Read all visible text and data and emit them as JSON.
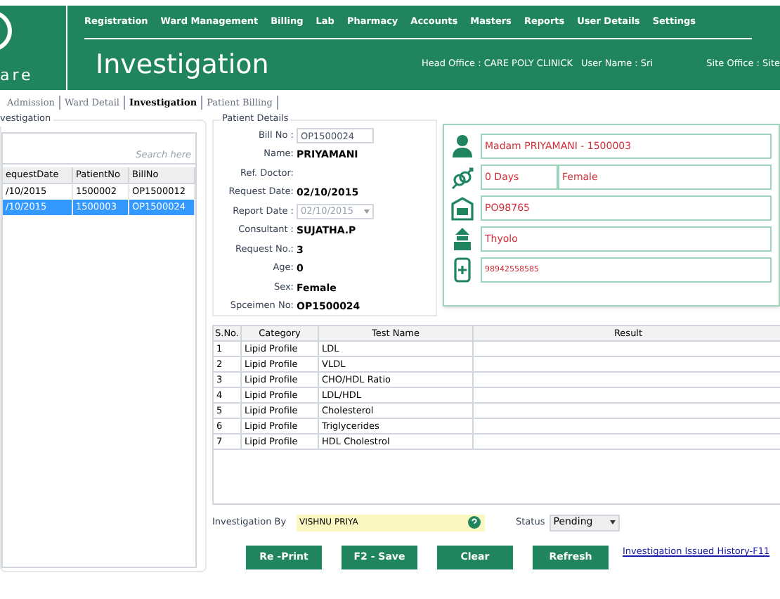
{
  "logo": {
    "text": "are"
  },
  "nav": [
    "Registration",
    "Ward Management",
    "Billing",
    "Lab",
    "Pharmacy",
    "Accounts",
    "Masters",
    "Reports",
    "User Details",
    "Settings"
  ],
  "page_title": "Investigation",
  "head_office": "Head Office :  CARE POLY CLINICK",
  "user_name": "User Name : Sri",
  "site_office": "Site Office : Site",
  "tabs": [
    {
      "label": "Admission",
      "selected": false
    },
    {
      "label": "Ward Detail",
      "selected": false
    },
    {
      "label": "Investigation",
      "selected": true
    },
    {
      "label": "Patient Billing",
      "selected": false
    }
  ],
  "left_panel": {
    "title": "vestigation",
    "search_placeholder": "Search here",
    "columns": [
      "equestDate",
      "PatientNo",
      "BillNo"
    ],
    "rows": [
      {
        "cells": [
          "/10/2015",
          "1500002",
          "OP1500012"
        ],
        "selected": false
      },
      {
        "cells": [
          "/10/2015",
          "1500003",
          "OP1500024"
        ],
        "selected": true
      }
    ]
  },
  "patient_details": {
    "title": "Patient Details",
    "fields": [
      {
        "label": "Bill No :",
        "value": "OP1500024",
        "kind": "input"
      },
      {
        "label": "Name:",
        "value": "PRIYAMANI",
        "kind": "text"
      },
      {
        "label": "Ref. Doctor:",
        "kind": "text"
      },
      {
        "label": "Request Date:",
        "value": "02/10/2015",
        "kind": "text"
      },
      {
        "label": "Report Date :",
        "value": "02/10/2015",
        "kind": "select"
      },
      {
        "label": "Consultant :",
        "value": "SUJATHA.P",
        "kind": "text"
      },
      {
        "label": "Request No.:",
        "value": "3",
        "kind": "text"
      },
      {
        "label": "Age:",
        "value": "0",
        "kind": "text"
      },
      {
        "label": "Sex:",
        "value": "Female",
        "kind": "text"
      },
      {
        "label": "Spceimen No:",
        "value": "OP1500024",
        "kind": "text"
      }
    ]
  },
  "contact_card": [
    {
      "kind": "person",
      "values": [
        "Madam PRIYAMANI - 1500003"
      ]
    },
    {
      "kind": "gender",
      "values": [
        "0 Days",
        "Female"
      ]
    },
    {
      "kind": "mail",
      "values": [
        "PO98765"
      ]
    },
    {
      "kind": "place",
      "values": [
        "Thyolo"
      ]
    },
    {
      "kind": "phone",
      "values": [
        "98942558585"
      ]
    }
  ],
  "tests_table": {
    "columns": [
      "S.No.",
      "Category",
      "Test Name",
      "Result"
    ],
    "rows": [
      [
        "1",
        "Lipid Profile",
        "LDL"
      ],
      [
        "2",
        "Lipid Profile",
        "VLDL"
      ],
      [
        "3",
        "Lipid Profile",
        "CHO/HDL Ratio"
      ],
      [
        "4",
        "Lipid Profile",
        "LDL/HDL"
      ],
      [
        "5",
        "Lipid Profile",
        "Cholesterol"
      ],
      [
        "6",
        "Lipid Profile",
        "Triglycerides"
      ],
      [
        "7",
        "Lipid Profile",
        "HDL Cholestrol"
      ]
    ]
  },
  "investigation_by": {
    "label": "Investigation By",
    "value": "VISHNU PRIYA"
  },
  "status": {
    "label": "Status",
    "value": "Pending"
  },
  "buttons": [
    "Re -Print",
    "F2 - Save",
    "Clear",
    "Refresh"
  ],
  "history_link": "Investigation Issued History-F11"
}
